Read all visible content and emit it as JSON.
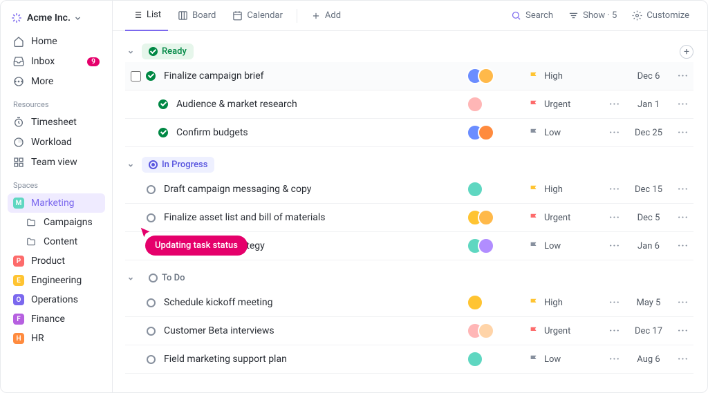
{
  "workspace": {
    "name": "Acme Inc."
  },
  "nav": {
    "home": "Home",
    "inbox": "Inbox",
    "inbox_count": "9",
    "more": "More"
  },
  "resources": {
    "label": "Resources",
    "timesheet": "Timesheet",
    "workload": "Workload",
    "team_view": "Team view"
  },
  "spaces": {
    "label": "Spaces",
    "items": [
      {
        "badge": "M",
        "color": "#5fd7c1",
        "name": "Marketing",
        "active": true,
        "children": [
          "Campaigns",
          "Content"
        ]
      },
      {
        "badge": "P",
        "color": "#fd6b6b",
        "name": "Product"
      },
      {
        "badge": "E",
        "color": "#ffc432",
        "name": "Engineering"
      },
      {
        "badge": "O",
        "color": "#7b68ee",
        "name": "Operations"
      },
      {
        "badge": "F",
        "color": "#b660e0",
        "name": "Finance"
      },
      {
        "badge": "H",
        "color": "#ff8b3e",
        "name": "HR"
      }
    ]
  },
  "tabs": {
    "list": "List",
    "board": "Board",
    "calendar": "Calendar",
    "add": "Add"
  },
  "toolbar": {
    "search": "Search",
    "show": "Show · 5",
    "customize": "Customize"
  },
  "sections": [
    {
      "id": "ready",
      "label": "Ready",
      "style": "ready",
      "tasks": [
        {
          "done": true,
          "title": "Finalize campaign brief",
          "avatars": [
            "#6b8dff",
            "#ffb94a"
          ],
          "prio": "High",
          "flag": "#ffc432",
          "date": "Dec 6",
          "first": true
        },
        {
          "done": true,
          "title": "Audience & market research",
          "avatars": [
            "#ffb6b6"
          ],
          "prio": "Urgent",
          "flag": "#fd6b6b",
          "date": "Jan 1",
          "sub": true,
          "dots": true
        },
        {
          "done": true,
          "title": "Confirm budgets",
          "avatars": [
            "#6b8dff",
            "#ff8b3e"
          ],
          "prio": "Low",
          "flag": "#87909e",
          "date": "Dec 25",
          "sub": true,
          "dots": true
        }
      ]
    },
    {
      "id": "progress",
      "label": "In Progress",
      "style": "progress",
      "tasks": [
        {
          "title": "Draft campaign messaging & copy",
          "avatars": [
            "#5fd7c1"
          ],
          "prio": "High",
          "flag": "#ffc432",
          "date": "Dec 15",
          "dots": true
        },
        {
          "title": "Finalize asset list and bill of materials",
          "avatars": [
            "#ffc432",
            "#ffb94a"
          ],
          "prio": "Urgent",
          "flag": "#fd6b6b",
          "date": "Dec 5",
          "dots": true
        },
        {
          "title": "Define channel strategy",
          "avatars": [
            "#5fd7c1",
            "#b18dff"
          ],
          "prio": "Low",
          "flag": "#87909e",
          "date": "Jan 6",
          "dots": true
        }
      ]
    },
    {
      "id": "todo",
      "label": "To Do",
      "style": "todo",
      "tasks": [
        {
          "title": "Schedule kickoff meeting",
          "avatars": [
            "#ffc432"
          ],
          "prio": "High",
          "flag": "#ffc432",
          "date": "May 5",
          "dots": true
        },
        {
          "title": "Customer Beta interviews",
          "avatars": [
            "#ffb6b6",
            "#ffd4a8"
          ],
          "prio": "Urgent",
          "flag": "#fd6b6b",
          "date": "Dec 17",
          "dots": true
        },
        {
          "title": "Field marketing support plan",
          "avatars": [
            "#5fd7c1"
          ],
          "prio": "Low",
          "flag": "#87909e",
          "date": "Aug 6",
          "dots": true
        }
      ]
    }
  ],
  "tooltip": "Updating task status"
}
